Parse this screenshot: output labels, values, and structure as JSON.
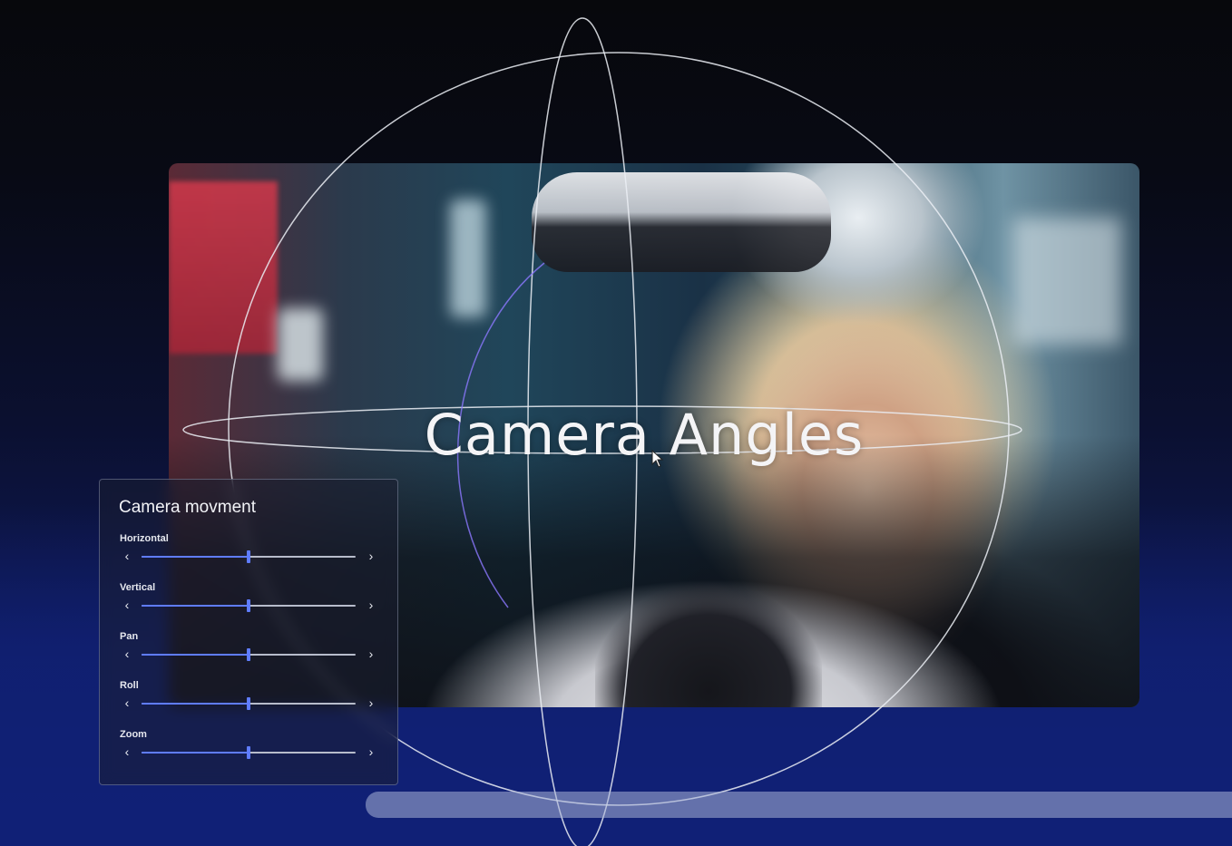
{
  "headline": "Camera Angles",
  "panel": {
    "title": "Camera movment",
    "controls": [
      {
        "label": "Horizontal",
        "value": 0.5
      },
      {
        "label": "Vertical",
        "value": 0.5
      },
      {
        "label": "Pan",
        "value": 0.5
      },
      {
        "label": "Roll",
        "value": 0.5
      },
      {
        "label": "Zoom",
        "value": 0.5
      }
    ],
    "left_arrow": "‹",
    "right_arrow": "›"
  },
  "colors": {
    "accent": "#5f7cff",
    "track": "#b7bccb"
  }
}
